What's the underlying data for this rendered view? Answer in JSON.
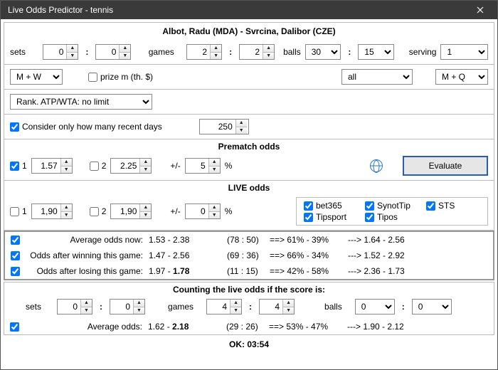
{
  "window": {
    "title": "Live Odds Predictor - tennis"
  },
  "match": {
    "title": "Albot, Radu (MDA) - Svrcina, Dalibor (CZE)"
  },
  "score": {
    "sets_label": "sets",
    "sets1": "0",
    "sets2": "0",
    "games_label": "games",
    "games1": "2",
    "games2": "2",
    "balls_label": "balls",
    "balls1": "30",
    "balls2": "15",
    "serving_label": "serving",
    "serving": "1"
  },
  "filters": {
    "gender": "M + W",
    "prize_label": "prize m (th. $)",
    "surface": "all",
    "round": "M + Q",
    "rank": "Rank. ATP/WTA: no limit",
    "recent_label": "Consider only how many recent days",
    "recent_days": "250"
  },
  "prematch": {
    "title": "Prematch odds",
    "chk1": "1",
    "val1": "1.57",
    "chk2": "2",
    "val2": "2.25",
    "pm_label": "+/-",
    "pm_val": "5",
    "pct": "%",
    "evaluate": "Evaluate"
  },
  "live": {
    "title": "LIVE odds",
    "chk1": "1",
    "val1": "1,90",
    "chk2": "2",
    "val2": "1,90",
    "pm_label": "+/-",
    "pm_val": "0",
    "pct": "%",
    "bmk": [
      "bet365",
      "SynotTip",
      "STS",
      "Tipsport",
      "Tipos"
    ]
  },
  "out": {
    "r1": {
      "label": "Average odds now:",
      "odds": "1.53 - 2.38",
      "cnt": "(78 : 50)",
      "pct": "==> 61%  -  39%",
      "res": "--->  1.64  -  2.56"
    },
    "r2": {
      "label": "Odds after winning this game:",
      "odds": "1.47 - 2.56",
      "cnt": "(69 : 36)",
      "pct": "==> 66%  -  34%",
      "res": "--->  1.52  -  2.92"
    },
    "r3": {
      "label": "Odds after losing this game:",
      "odds_html": "1.97 - <b>1.78</b>",
      "cnt": "(11 : 15)",
      "pct": "==> 42%  -  58%",
      "res": "--->  2.36  -  1.73"
    }
  },
  "counting": {
    "title": "Counting the live odds if the score is:",
    "sets_label": "sets",
    "sets1": "0",
    "sets2": "0",
    "games_label": "games",
    "games1": "4",
    "games2": "4",
    "balls_label": "balls",
    "balls1": "0",
    "balls2": "0",
    "avg": {
      "label": "Average odds:",
      "odds_html": "1.62 - <b>2.18</b>",
      "cnt": "(29 : 26)",
      "pct": "==> 53%  -  47%",
      "res": "--->  1.90  -  2.12"
    }
  },
  "footer": {
    "status": "OK: 03:54"
  }
}
